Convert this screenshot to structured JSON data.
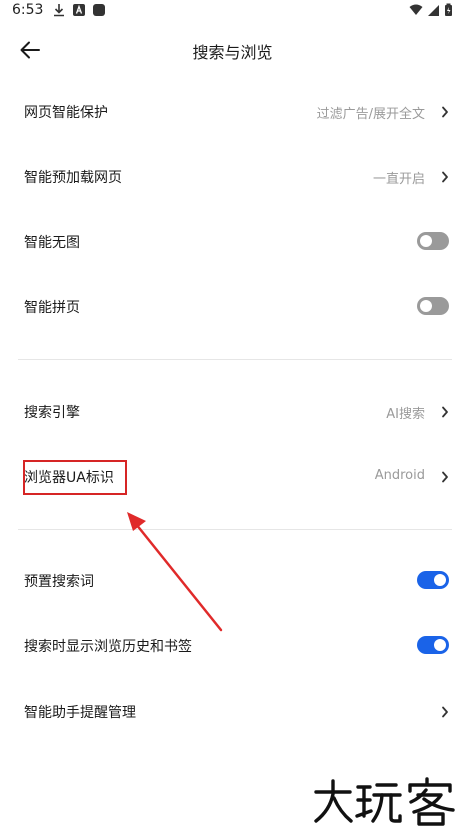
{
  "status_bar": {
    "time": "6:53",
    "icons_left": [
      "download-icon",
      "a-badge-icon",
      "notification-square-icon"
    ],
    "icons_right": [
      "wifi-icon",
      "signal-icon",
      "battery-icon"
    ]
  },
  "header": {
    "title": "搜索与浏览",
    "back_icon": "back-arrow-icon"
  },
  "settings": {
    "web_protection": {
      "label": "网页智能保护",
      "value": "过滤广告/展开全文"
    },
    "preload": {
      "label": "智能预加载网页",
      "value": "一直开启"
    },
    "no_image": {
      "label": "智能无图",
      "enabled": false
    },
    "page_join": {
      "label": "智能拼页",
      "enabled": false
    },
    "search_engine": {
      "label": "搜索引擎",
      "value": "AI搜索"
    },
    "ua": {
      "label": "浏览器UA标识",
      "value": "Android"
    },
    "preset_words": {
      "label": "预置搜索词",
      "enabled": true
    },
    "show_history": {
      "label": "搜索时显示浏览历史和书签",
      "enabled": true
    },
    "assistant": {
      "label": "智能助手提醒管理"
    }
  },
  "colors": {
    "toggle_on": "#1a63e8",
    "toggle_off": "#9a9a9a",
    "annotation": "#d62525"
  },
  "annotation": {
    "target": "浏览器UA标识"
  },
  "watermark": {
    "text": "大玩客"
  }
}
